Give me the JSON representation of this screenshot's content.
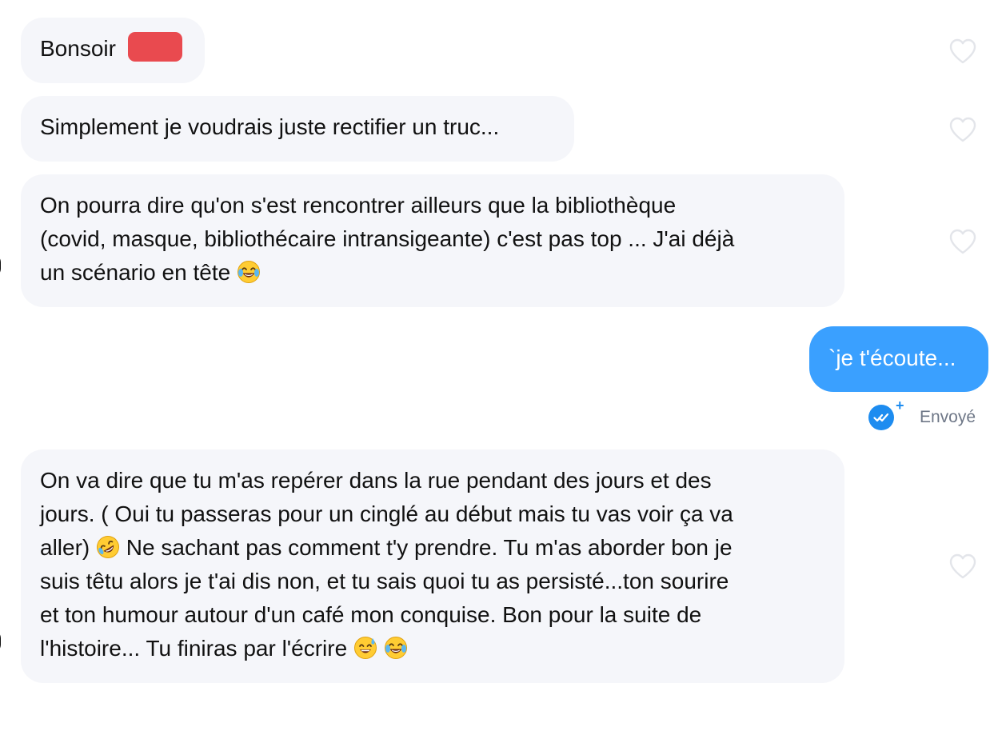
{
  "messages": [
    {
      "text": "Bonsoir "
    },
    {
      "text": "Simplement je voudrais juste rectifier un truc..."
    },
    {
      "line1": "On pourra dire qu'on s'est  rencontrer ailleurs que la bibliothèque",
      "line2": "(covid, masque, bibliothécaire intransigeante) c'est pas top ... J'ai déjà",
      "line3": "un scénario en tête "
    },
    {
      "line1": "On va dire que tu m'as repérer dans la rue pendant des jours et des",
      "line2": "jours. ( Oui tu passeras pour un cinglé au début mais tu vas voir ça va",
      "line3a": "aller) ",
      "line3b": "  Ne sachant pas comment t'y prendre. Tu m'as aborder bon je",
      "line4": "suis têtu alors je t'ai dis non, et tu sais quoi tu as persisté...ton sourire",
      "line5": "et ton humour autour d'un café mon conquise. Bon pour la suite de",
      "line6": "l'histoire... Tu finiras par l'écrire "
    }
  ],
  "sent_message": {
    "text": "`je t'écoute..."
  },
  "status": {
    "label": "Envoyé",
    "plus": "+"
  },
  "icons": {
    "heart": "heart-outline-icon",
    "read_receipt": "double-check-icon",
    "emoji_laugh": "face-with-tears-of-joy-emoji",
    "emoji_rofl": "rolling-on-floor-laughing-emoji",
    "emoji_sweat": "grinning-face-with-sweat-emoji"
  },
  "colors": {
    "received_bubble": "#f5f6fa",
    "sent_bubble": "#3aa0ff",
    "redaction": "#e94a4f",
    "status_blue": "#1d8cf0",
    "status_text": "#6e7787"
  }
}
